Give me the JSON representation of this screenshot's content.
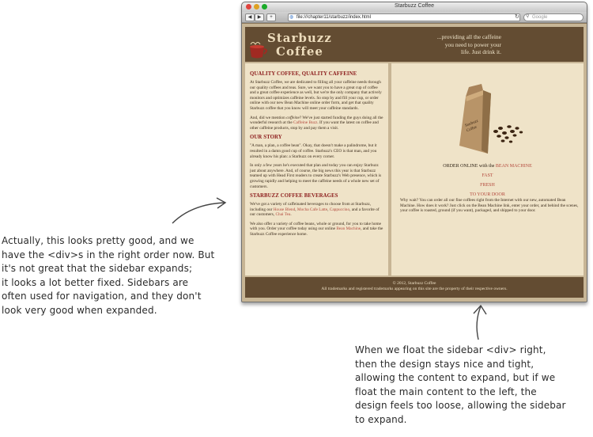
{
  "window": {
    "title": "Starbuzz Coffee",
    "url": "file:///chapter11/starbuzz/index.html",
    "search_placeholder": "Google",
    "back_label": "◀",
    "forward_label": "▶",
    "add_label": "+"
  },
  "header": {
    "logo_line1": "Starbuzz",
    "logo_line2": "Coffee",
    "tagline": [
      "...providing all the caffeine",
      "you need to power your",
      "life. Just drink it."
    ]
  },
  "main": {
    "sections": [
      {
        "heading": "QUALITY COFFEE, QUALITY CAFFEINE",
        "paragraphs": [
          "At Starbuzz Coffee, we are dedicated to filling all your caffeine needs through our quality coffees and teas. Sure, we want you to have a great cup of coffee and a great coffee experience as well, but we're the only company that actively monitors and optimizes caffeine levels. So stop by and fill your cup, or order online with our new Bean Machine online order form, and get that quality Starbuzz coffee that you know will meet your caffeine standards."
        ],
        "extra_before": "And, did we mention ",
        "extra_em": "coffeine",
        "extra_mid": "? We've just started funding the guys doing all the wonderful research at the ",
        "extra_link": "Caffeine Buzz",
        "extra_after": ". If you want the latest on coffee and other caffeine products, stop by and pay them a visit."
      },
      {
        "heading": "OUR STORY",
        "paragraphs": [
          "\"A man, a plan, a coffee bean\". Okay, that doesn't make a palindrome, but it resulted in a damn good cup of coffee. Starbuzz's CEO is that man, and you already know his plan: a Starbuzz on every corner.",
          "In only a few years he's executed that plan and today you can enjoy Starbuzz just about anywhere. And, of course, the big news this year is that Starbuzz teamed up with Head First readers to create Starbuzz's Web presence, which is growing rapidly and helping to meet the caffeine needs of a whole new set of customers."
        ]
      },
      {
        "heading": "STARBUZZ COFFEE BEVERAGES",
        "bev_before": "We've got a variety of caffeinated beverages to choose from at Starbuzz, including our ",
        "bev_link1": "House Blend",
        "bev_sep1": ", ",
        "bev_link2": "Mocha Cafe Latte",
        "bev_sep2": ", ",
        "bev_link3": "Cappuccino",
        "bev_mid": ", and a favorite of our customers, ",
        "bev_link4": "Chai Tea",
        "bev_end": ".",
        "order_before": "We also offer a variety of coffee beans, whole or ground, for you to take home with you. Order your coffee today using our online ",
        "order_link": "Bean Machine",
        "order_after": ", and take the Starbuzz Coffee experience home."
      }
    ]
  },
  "sidebar": {
    "bag_label_1": "Starbuzz",
    "bag_label_2": "Coffee",
    "order_prefix": "ORDER ONLINE with the ",
    "order_link": "BEAN MACHINE",
    "fast": "FAST",
    "fresh": "FRESH",
    "to_your_door": "TO YOUR DOOR",
    "description": "Why wait? You can order all our fine coffees right from the Internet with our new, automated Bean Machine. How does it work? Just click on the Bean Machine link, enter your order, and behind the scenes, your coffee is roasted, ground (if you want), packaged, and shipped to your door."
  },
  "footer": {
    "line1": "© 2012, Starbuzz Coffee",
    "line2": "All trademarks and registered trademarks appearing on this site are the property of their respective owners."
  },
  "annotations": {
    "left": [
      "Actually, this looks pretty good, and we",
      "have the <div>s in the right order now. But",
      "it's not great that the sidebar expands;",
      "it looks a lot better fixed. Sidebars are",
      "often used for navigation, and they don't",
      "look very good when expanded."
    ],
    "right": [
      "When we float the sidebar <div> right,",
      "then the design stays nice and tight,",
      "allowing the content to expand, but if we",
      "float the main content to the left, the",
      "design feels too loose, allowing the sidebar",
      "to expand."
    ]
  },
  "colors": {
    "header_bg": "#634c32",
    "content_bg": "#efe3c8",
    "page_bg": "#c7b595",
    "heading": "#8b1a1a",
    "link": "#b3483c"
  }
}
